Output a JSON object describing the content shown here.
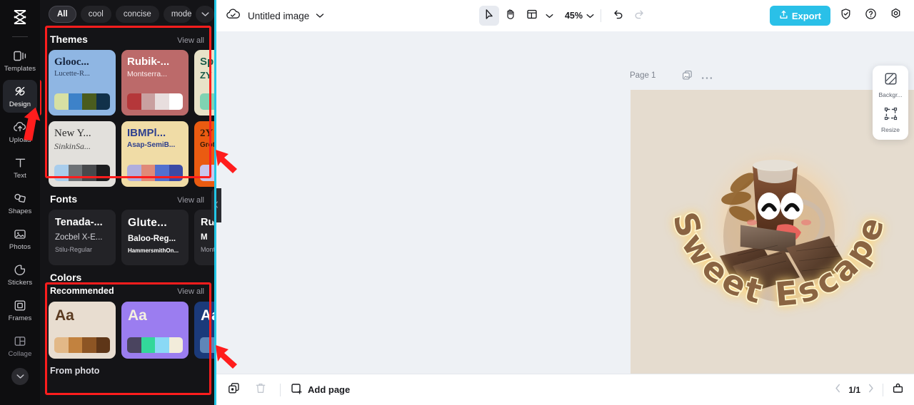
{
  "rail": {
    "logo": "capcut-logo",
    "items": [
      {
        "label": "Templates",
        "icon": "templates-icon",
        "active": false
      },
      {
        "label": "Design",
        "icon": "design-icon",
        "active": true
      },
      {
        "label": "Upload",
        "icon": "upload-icon",
        "active": false
      },
      {
        "label": "Text",
        "icon": "text-icon",
        "active": false
      },
      {
        "label": "Shapes",
        "icon": "shapes-icon",
        "active": false
      },
      {
        "label": "Photos",
        "icon": "photos-icon",
        "active": false
      },
      {
        "label": "Stickers",
        "icon": "stickers-icon",
        "active": false
      },
      {
        "label": "Frames",
        "icon": "frames-icon",
        "active": false
      },
      {
        "label": "Collage",
        "icon": "collage-icon",
        "active": false
      }
    ],
    "expand_icon": "chevron-down-icon"
  },
  "panel": {
    "chips": [
      {
        "label": "All",
        "selected": true
      },
      {
        "label": "cool",
        "selected": false
      },
      {
        "label": "concise",
        "selected": false
      },
      {
        "label": "modern",
        "selected": false
      }
    ],
    "chips_more_icon": "chevron-down-icon",
    "themes": {
      "title": "Themes",
      "view_all": "View all",
      "next_icon": "chevron-right-icon",
      "cards": [
        {
          "name1": "Glooc...",
          "name2": "Lucette-R...",
          "bg": "#8fb6e3",
          "fg1": "#15233c",
          "fg2": "#2c3e5c",
          "swatches": [
            "#d7e0a3",
            "#3d82c9",
            "#4a5c1e",
            "#11314a"
          ]
        },
        {
          "name1": "Rubik-...",
          "name2": "Montserra...",
          "bg": "#bc6a6a",
          "fg1": "#ffffff",
          "fg2": "#fbeeee",
          "swatches": [
            "#b5373a",
            "#c9a0a0",
            "#e8dede",
            "#ffffff"
          ]
        },
        {
          "name1": "Sp",
          "name2": "ZY",
          "bg": "#e8e2c8",
          "fg1": "#1d5b4a",
          "fg2": "#1d5b4a",
          "swatches": [
            "#7fd3b2",
            "#7fd3b2",
            "#7fd3b2",
            "#7fd3b2"
          ]
        },
        {
          "name1": "New Y...",
          "name2": "SinkinSa...",
          "bg": "#e2e0dc",
          "fg1": "#2a2a2a",
          "fg2": "#4a4a4a",
          "swatches": [
            "#a9cdec",
            "#6e7276",
            "#47494c",
            "#1c1d1f"
          ]
        },
        {
          "name1": "IBMPl...",
          "name2": "Asap-SemiB...",
          "bg": "#f0dca6",
          "fg1": "#2d3f8e",
          "fg2": "#2d3f8e",
          "swatches": [
            "#b0aede",
            "#e08a78",
            "#5270cf",
            "#3b4aa5"
          ]
        },
        {
          "name1": "2Y",
          "name2": "Grot",
          "bg": "#ea5b11",
          "fg1": "#3a1a06",
          "fg2": "#3a1a06",
          "swatches": [
            "#c9c6ec",
            "#c9c6ec",
            "#c9c6ec",
            "#c9c6ec"
          ]
        }
      ]
    },
    "fonts": {
      "title": "Fonts",
      "view_all": "View all",
      "next_icon": "chevron-right-icon",
      "cards": [
        {
          "l1": "Tenada-...",
          "l2": "Zocbel X-E...",
          "l3": "Stilu-Regular",
          "bold2": false
        },
        {
          "l1": "Glute...",
          "l2": "Baloo-Reg...",
          "l3": "HammersmithOn...",
          "bold2": true
        },
        {
          "l1": "Ru",
          "l2": "M",
          "l3": "Mont",
          "bold2": true
        }
      ]
    },
    "colors": {
      "title": "Colors",
      "subtitle": "Recommended",
      "view_all": "View all",
      "next_icon": "chevron-right-icon",
      "cards": [
        {
          "aa": "Aa",
          "bg": "#e8ddd0",
          "fg": "#5a3a20",
          "swatches": [
            "#e2b887",
            "#c2823f",
            "#8d5524",
            "#5e3618"
          ]
        },
        {
          "aa": "Aa",
          "bg": "#9b7df0",
          "fg": "#f4f0e0",
          "swatches": [
            "#4a445f",
            "#33d79a",
            "#8ad9f5",
            "#f2ecda"
          ]
        },
        {
          "aa": "Aa",
          "bg": "#1b3a7a",
          "fg": "#ffffff",
          "swatches": [
            "#5f86b8",
            "#5f86b8",
            "#5f86b8",
            "#5f86b8"
          ]
        }
      ]
    },
    "from_photo": "From photo",
    "collapse_icon": "chevron-left-icon"
  },
  "topbar": {
    "cloud_icon": "cloud-saved-icon",
    "title": "Untitled image",
    "title_chevron": "chevron-down-icon",
    "tools": [
      {
        "icon": "cursor-select-icon",
        "active": true
      },
      {
        "icon": "hand-pan-icon",
        "active": false
      },
      {
        "icon": "layout-grid-icon",
        "active": false
      }
    ],
    "layout_chevron": "chevron-down-icon",
    "zoom": "45%",
    "zoom_chevron": "chevron-down-icon",
    "undo_icon": "undo-icon",
    "redo_icon": "redo-icon",
    "export_label": "Export",
    "export_icon": "export-upload-icon",
    "export_color": "#2ac0e8",
    "right_icons": [
      "shield-check-icon",
      "help-circle-icon",
      "settings-gear-icon"
    ]
  },
  "canvas": {
    "page_label": "Page 1",
    "copy_icon": "duplicate-page-icon",
    "more_icon": "more-horizontal-icon",
    "artboard_bg": "#e5dccf",
    "design_text": "Sweet Escape",
    "floating": [
      {
        "label": "Backgr...",
        "icon": "background-icon"
      },
      {
        "label": "Resize",
        "icon": "resize-icon"
      }
    ]
  },
  "bottombar": {
    "duplicate_icon": "duplicate-icon",
    "delete_icon": "trash-icon",
    "add_page_label": "Add page",
    "add_page_icon": "add-page-icon",
    "prev_icon": "chevron-left-icon",
    "page_indicator": "1/1",
    "next_icon": "chevron-right-icon",
    "present_icon": "present-icon"
  },
  "annotations": {
    "highlight_color": "#ff1d1d"
  }
}
